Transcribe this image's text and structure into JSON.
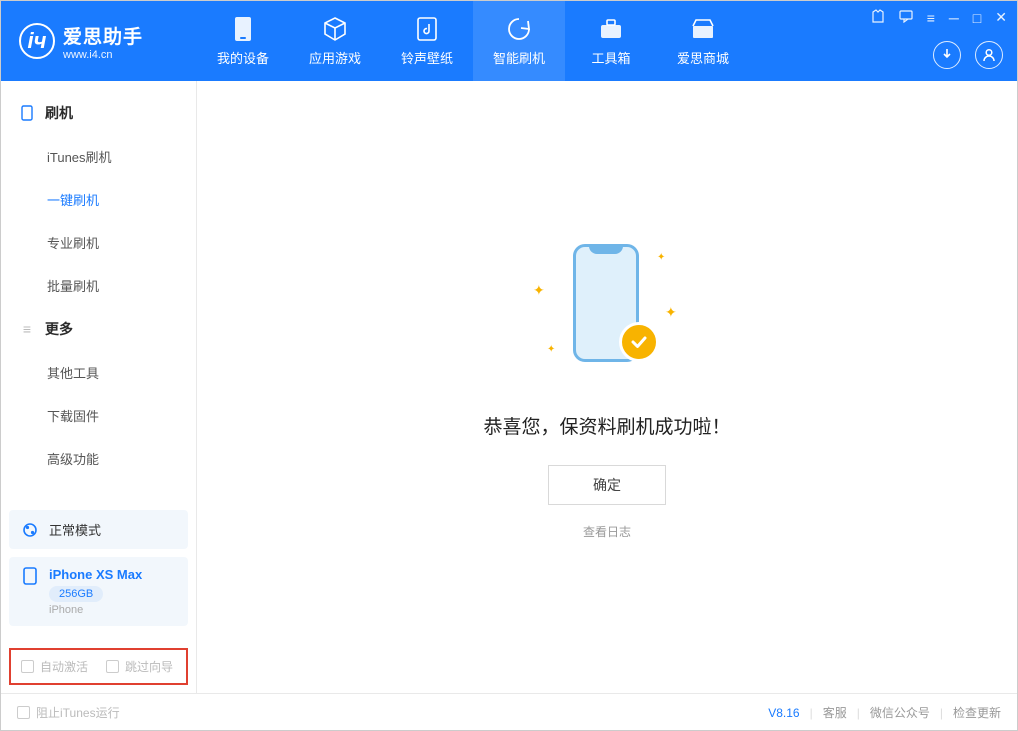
{
  "app": {
    "name": "爱思助手",
    "url": "www.i4.cn"
  },
  "tabs": {
    "device": "我的设备",
    "apps": "应用游戏",
    "ring": "铃声壁纸",
    "flash": "智能刷机",
    "tools": "工具箱",
    "store": "爱思商城"
  },
  "sidebar": {
    "cat_flash": "刷机",
    "items_flash": {
      "itunes": "iTunes刷机",
      "onekey": "一键刷机",
      "pro": "专业刷机",
      "batch": "批量刷机"
    },
    "cat_more": "更多",
    "items_more": {
      "other": "其他工具",
      "firmware": "下载固件",
      "advanced": "高级功能"
    }
  },
  "device_status": {
    "mode": "正常模式"
  },
  "device_info": {
    "name": "iPhone XS Max",
    "storage": "256GB",
    "type": "iPhone"
  },
  "checks": {
    "auto_activate": "自动激活",
    "skip_guide": "跳过向导"
  },
  "main": {
    "message": "恭喜您，保资料刷机成功啦！",
    "ok": "确定",
    "view_log": "查看日志"
  },
  "footer": {
    "block_itunes": "阻止iTunes运行",
    "version": "V8.16",
    "support": "客服",
    "wechat": "微信公众号",
    "update": "检查更新"
  }
}
